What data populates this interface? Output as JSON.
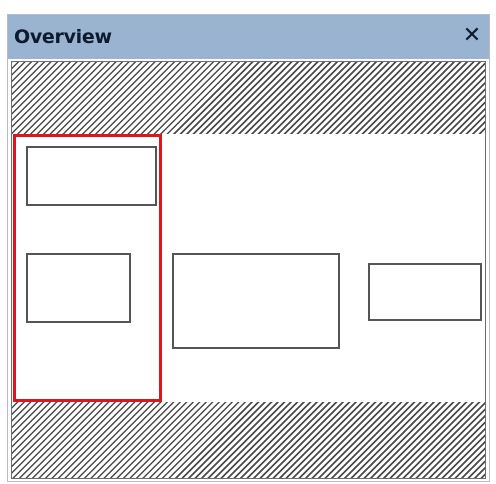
{
  "panel": {
    "title": "Overview",
    "close_glyph": "✕",
    "close_icon": "close-icon"
  },
  "colors": {
    "titlebar": "#99b3d1",
    "viewport_border": "#e0141a",
    "node_border": "#555555",
    "hatch": "#4a4a4a"
  }
}
